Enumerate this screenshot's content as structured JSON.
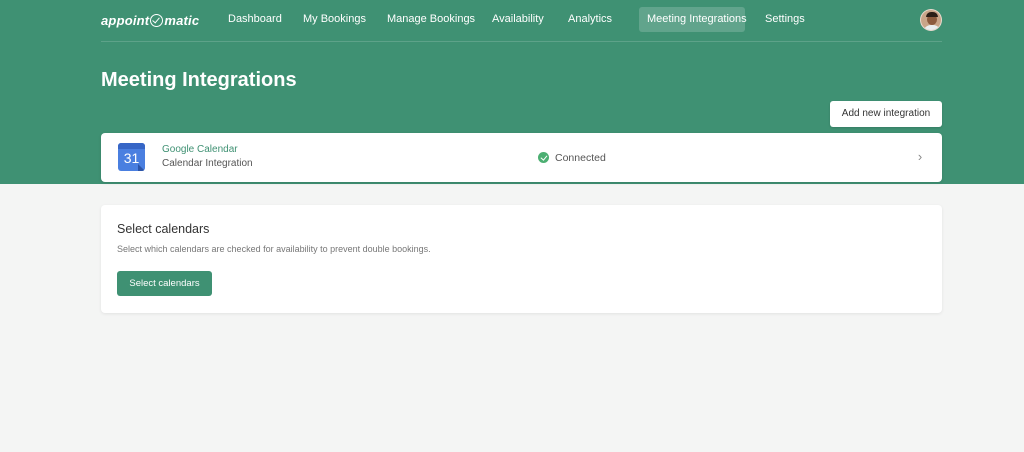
{
  "brand": {
    "logo_left": "appoint",
    "logo_right": "matic"
  },
  "nav": {
    "items": [
      {
        "label": "Dashboard",
        "active": false
      },
      {
        "label": "My Bookings",
        "active": false
      },
      {
        "label": "Manage Bookings",
        "active": false
      },
      {
        "label": "Availability",
        "active": false
      },
      {
        "label": "Analytics",
        "active": false
      },
      {
        "label": "Meeting Integrations",
        "active": true
      },
      {
        "label": "Settings",
        "active": false
      }
    ]
  },
  "page": {
    "title": "Meeting Integrations",
    "add_button_label": "Add new integration"
  },
  "integration": {
    "icon_number": "31",
    "name": "Google Calendar",
    "type": "Calendar Integration",
    "status": "Connected"
  },
  "calendars": {
    "title": "Select calendars",
    "description": "Select which calendars are checked for availability to prevent double bookings.",
    "button_label": "Select calendars"
  },
  "colors": {
    "brand": "#3f9173",
    "connected": "#4caf72"
  }
}
